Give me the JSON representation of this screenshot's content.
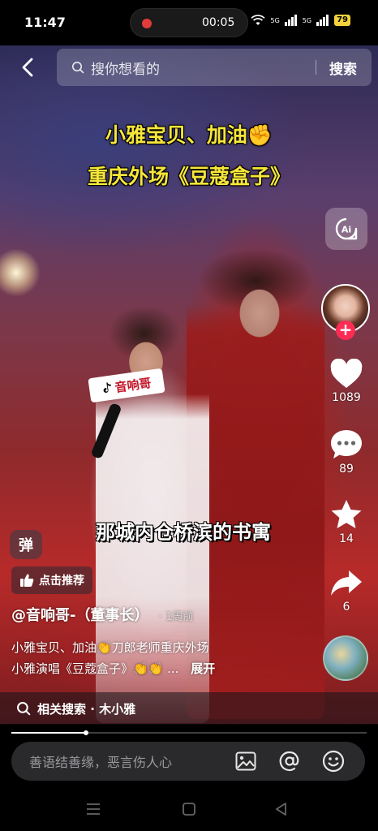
{
  "status_bar": {
    "time": "11:47",
    "record_time": "00:05",
    "signal1": "5G",
    "signal2": "5G",
    "battery": "79"
  },
  "search": {
    "placeholder": "搜你想看的",
    "button": "搜索"
  },
  "video": {
    "caption_line1": "小雅宝贝、加油✊",
    "caption_line2": "重庆外场《豆蔻盒子》",
    "subtitle": "那城内仓桥滨的书寓",
    "mic_label": "音响哥"
  },
  "rail": {
    "ai_label": "Ai",
    "likes": "1089",
    "comments": "89",
    "favorites": "14",
    "shares": "6"
  },
  "info": {
    "danmaku_label": "弹",
    "recommend_label": "点击推荐",
    "author": "@音响哥-（董事长）",
    "time_ago": "· 1周前",
    "description_line1": "小雅宝贝、加油👏刀郎老师重庆外场",
    "description_line2": "小雅演唱《豆蔻盒子》👏👏 ...",
    "expand": "展开"
  },
  "related": {
    "label": "相关搜索 · 木小雅"
  },
  "progress": {
    "value": 0.21
  },
  "comment": {
    "placeholder": "善语结善缘，恶言伤人心"
  },
  "colors": {
    "caption": "#f6e63a",
    "follow": "#fe2c55",
    "battery": "#f3d23a"
  }
}
